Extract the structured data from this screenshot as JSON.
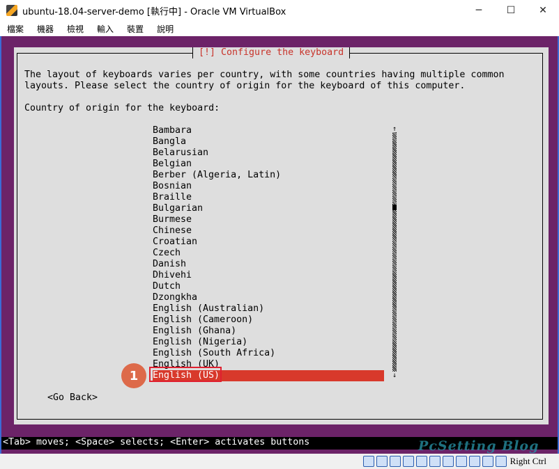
{
  "window": {
    "title": "ubuntu-18.04-server-demo [執行中] - Oracle VM VirtualBox",
    "minimize": "─",
    "maximize": "☐",
    "close": "✕"
  },
  "menu": [
    "檔案",
    "機器",
    "檢視",
    "輸入",
    "裝置",
    "說明"
  ],
  "dialog": {
    "title": "[!] Configure the keyboard",
    "intro": "The layout of keyboards varies per country, with some countries having multiple common\nlayouts. Please select the country of origin for the keyboard of this computer.",
    "label": "Country of origin for the keyboard:",
    "items": [
      "Bambara",
      "Bangla",
      "Belarusian",
      "Belgian",
      "Berber (Algeria, Latin)",
      "Bosnian",
      "Braille",
      "Bulgarian",
      "Burmese",
      "Chinese",
      "Croatian",
      "Czech",
      "Danish",
      "Dhivehi",
      "Dutch",
      "Dzongkha",
      "English (Australian)",
      "English (Cameroon)",
      "English (Ghana)",
      "English (Nigeria)",
      "English (South Africa)",
      "English (UK)",
      "English (US)"
    ],
    "selected": "English (US)",
    "scroll_up": "↑",
    "scroll_down": "↓",
    "go_back": "<Go Back>",
    "step_badge": "1"
  },
  "help": "<Tab> moves; <Space> selects; <Enter> activates buttons",
  "watermark": "PcSetting Blog",
  "status": {
    "icons": [
      "hard-disk-icon",
      "optical-disk-icon",
      "audio-icon",
      "network-icon",
      "usb-icon",
      "shared-folder-icon",
      "display-icon",
      "snapshot-icon",
      "cpu-icon",
      "mouse-integration-icon",
      "keyboard-capture-icon"
    ],
    "host_key": "Right Ctrl"
  },
  "colors": {
    "vm_bg": "#6c2368",
    "dialog_bg": "#dedede",
    "accent": "#d8392b",
    "title_text": "#c8332a"
  }
}
